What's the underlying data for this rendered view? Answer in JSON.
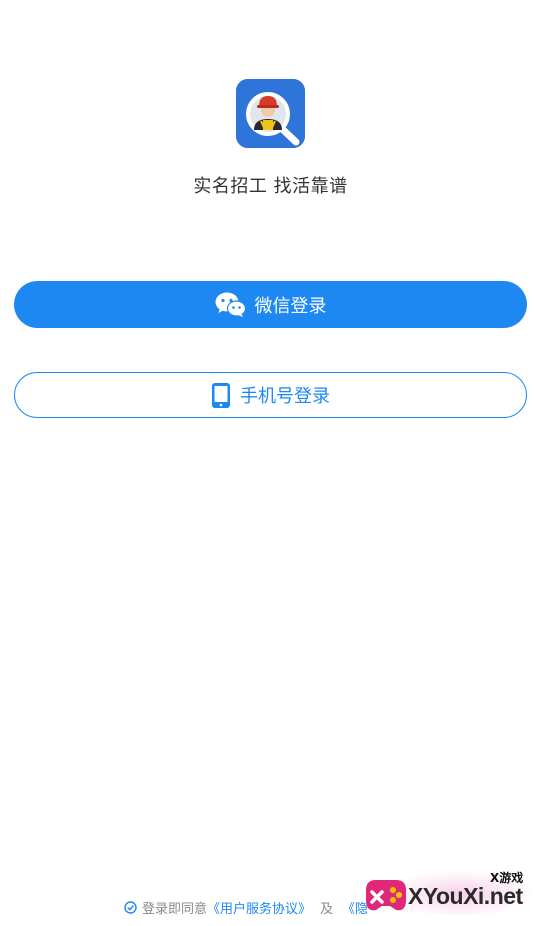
{
  "app": {
    "slogan": "实名招工 找活靠谱",
    "icon": "worker-magnifier-icon",
    "accent_color": "#1e88f2"
  },
  "buttons": {
    "wechat_label": "微信登录",
    "wechat_icon": "wechat-icon",
    "phone_label": "手机号登录",
    "phone_icon": "smartphone-icon"
  },
  "agreement": {
    "prefix": "登录即同意",
    "user_service": "《用户服务协议》",
    "and": "及",
    "privacy": "《隐"
  },
  "watermark": {
    "main": "XYouXi.net",
    "sub": "X游戏"
  }
}
